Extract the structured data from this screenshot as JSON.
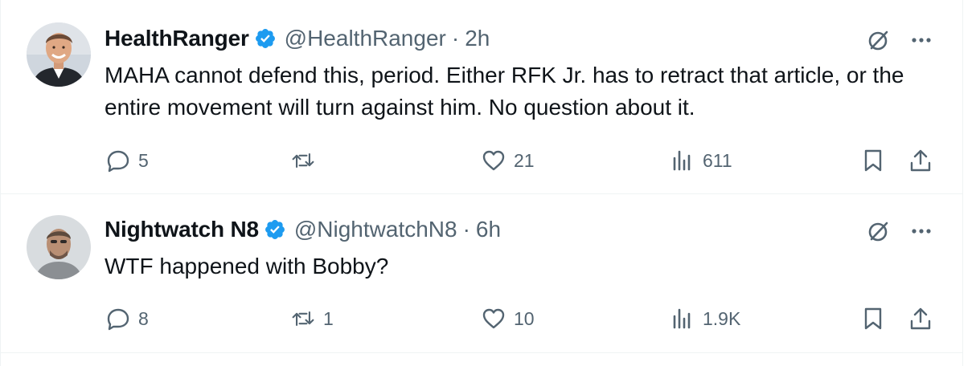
{
  "colors": {
    "text": "#0f1419",
    "secondary": "#536471",
    "verified": "#1d9bf0",
    "divider": "#eff3f4"
  },
  "tweets": [
    {
      "author_name": "HealthRanger",
      "handle": "@HealthRanger",
      "separator": "·",
      "time": "2h",
      "verified": true,
      "text": "MAHA cannot defend this, period. Either RFK Jr. has to retract that article, or the entire movement will turn against him. No question about it.",
      "replies": "5",
      "retweets": "",
      "likes": "21",
      "views": "611",
      "icons": [
        "reply-icon",
        "retweet-icon",
        "like-icon",
        "views-icon",
        "bookmark-icon",
        "share-icon",
        "grok-icon",
        "more-icon"
      ]
    },
    {
      "author_name": "Nightwatch N8",
      "handle": "@NightwatchN8",
      "separator": "·",
      "time": "6h",
      "verified": true,
      "text": "WTF happened with Bobby?",
      "replies": "8",
      "retweets": "1",
      "likes": "10",
      "views": "1.9K",
      "icons": [
        "reply-icon",
        "retweet-icon",
        "like-icon",
        "views-icon",
        "bookmark-icon",
        "share-icon",
        "grok-icon",
        "more-icon"
      ]
    }
  ]
}
